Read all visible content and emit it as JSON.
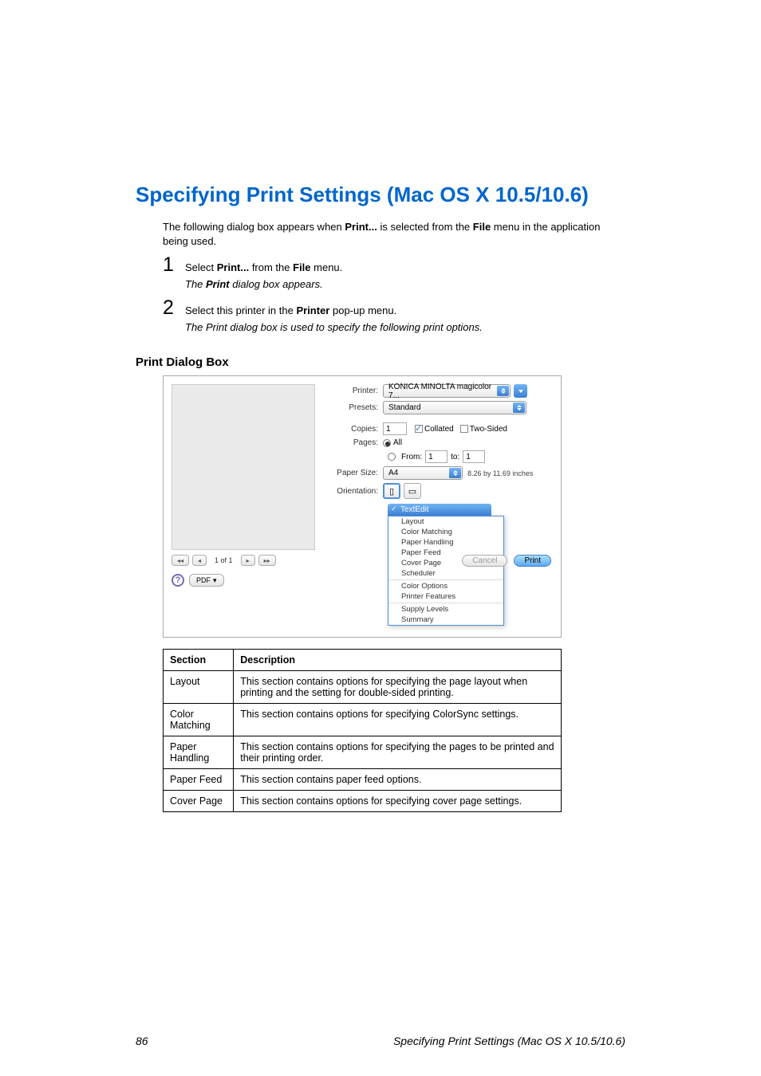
{
  "heading": "Specifying Print Settings (Mac OS X 10.5/10.6)",
  "intro_parts": {
    "a": "The following dialog box appears when ",
    "b": "Print...",
    "c": " is selected from the ",
    "d": "File",
    "e": " menu in the application being used."
  },
  "step1": {
    "num": "1",
    "a": "Select ",
    "b": "Print...",
    "c": " from the ",
    "d": "File",
    "e": " menu."
  },
  "step1_sub": {
    "a": "The ",
    "b": "Print",
    "c": " dialog box appears."
  },
  "step2": {
    "num": "2",
    "a": "Select this printer in the ",
    "b": "Printer",
    "c": " pop-up menu."
  },
  "step2_sub": "The Print dialog box is used to specify the following print options.",
  "subheading": "Print Dialog Box",
  "dialog": {
    "printer_label": "Printer:",
    "printer_value": "KONICA MINOLTA magicolor 7...",
    "presets_label": "Presets:",
    "presets_value": "Standard",
    "copies_label": "Copies:",
    "copies_value": "1",
    "collated": "Collated",
    "twosided": "Two-Sided",
    "pages_label": "Pages:",
    "pages_all": "All",
    "pages_from": "From:",
    "pages_from_v": "1",
    "pages_to": "to:",
    "pages_to_v": "1",
    "paper_label": "Paper Size:",
    "paper_value": "A4",
    "paper_note": "8.26 by 11.69 inches",
    "orient_label": "Orientation:",
    "pager_text": "1 of 1",
    "pdf_label": "PDF",
    "help_q": "?",
    "dd_selected": "TextEdit",
    "dd_items": [
      "Layout",
      "Color Matching",
      "Paper Handling",
      "Paper Feed",
      "Cover Page",
      "Scheduler",
      "",
      "Color Options",
      "Printer Features",
      "",
      "Supply Levels",
      "Summary"
    ],
    "cancel": "Cancel",
    "print": "Print"
  },
  "table": {
    "h1": "Section",
    "h2": "Description",
    "rows": [
      {
        "s": "Layout",
        "d": "This section contains options for specifying the page layout when printing and the setting for double-sided printing."
      },
      {
        "s": "Color Matching",
        "d": "This section contains options for specifying ColorSync settings."
      },
      {
        "s": "Paper Handling",
        "d": "This section contains options for specifying the pages to be printed and their printing order."
      },
      {
        "s": "Paper Feed",
        "d": "This section contains paper feed options."
      },
      {
        "s": "Cover Page",
        "d": "This section contains options for specifying cover page settings."
      }
    ]
  },
  "footer": {
    "page": "86",
    "title": "Specifying Print Settings (Mac OS X 10.5/10.6)"
  }
}
